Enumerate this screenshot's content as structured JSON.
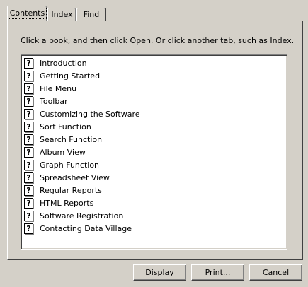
{
  "tabs": [
    {
      "label": "Contents",
      "active": true
    },
    {
      "label": "Index",
      "active": false
    },
    {
      "label": "Find",
      "active": false
    }
  ],
  "instruction": "Click a book, and then click Open. Or click another tab, such as Index.",
  "topic_icon": "help-topic-icon",
  "topic_icon_glyph": "?",
  "topics": [
    "Introduction",
    "Getting Started",
    "File Menu",
    "Toolbar",
    "Customizing the Software",
    "Sort Function",
    "Search Function",
    "Album View",
    "Graph Function",
    "Spreadsheet View",
    "Regular Reports",
    "HTML Reports",
    "Software Registration",
    "Contacting Data Village"
  ],
  "buttons": {
    "display": {
      "mnemonic": "D",
      "rest": "isplay"
    },
    "print": {
      "mnemonic": "P",
      "rest": "rint..."
    },
    "cancel": {
      "label": "Cancel"
    }
  }
}
